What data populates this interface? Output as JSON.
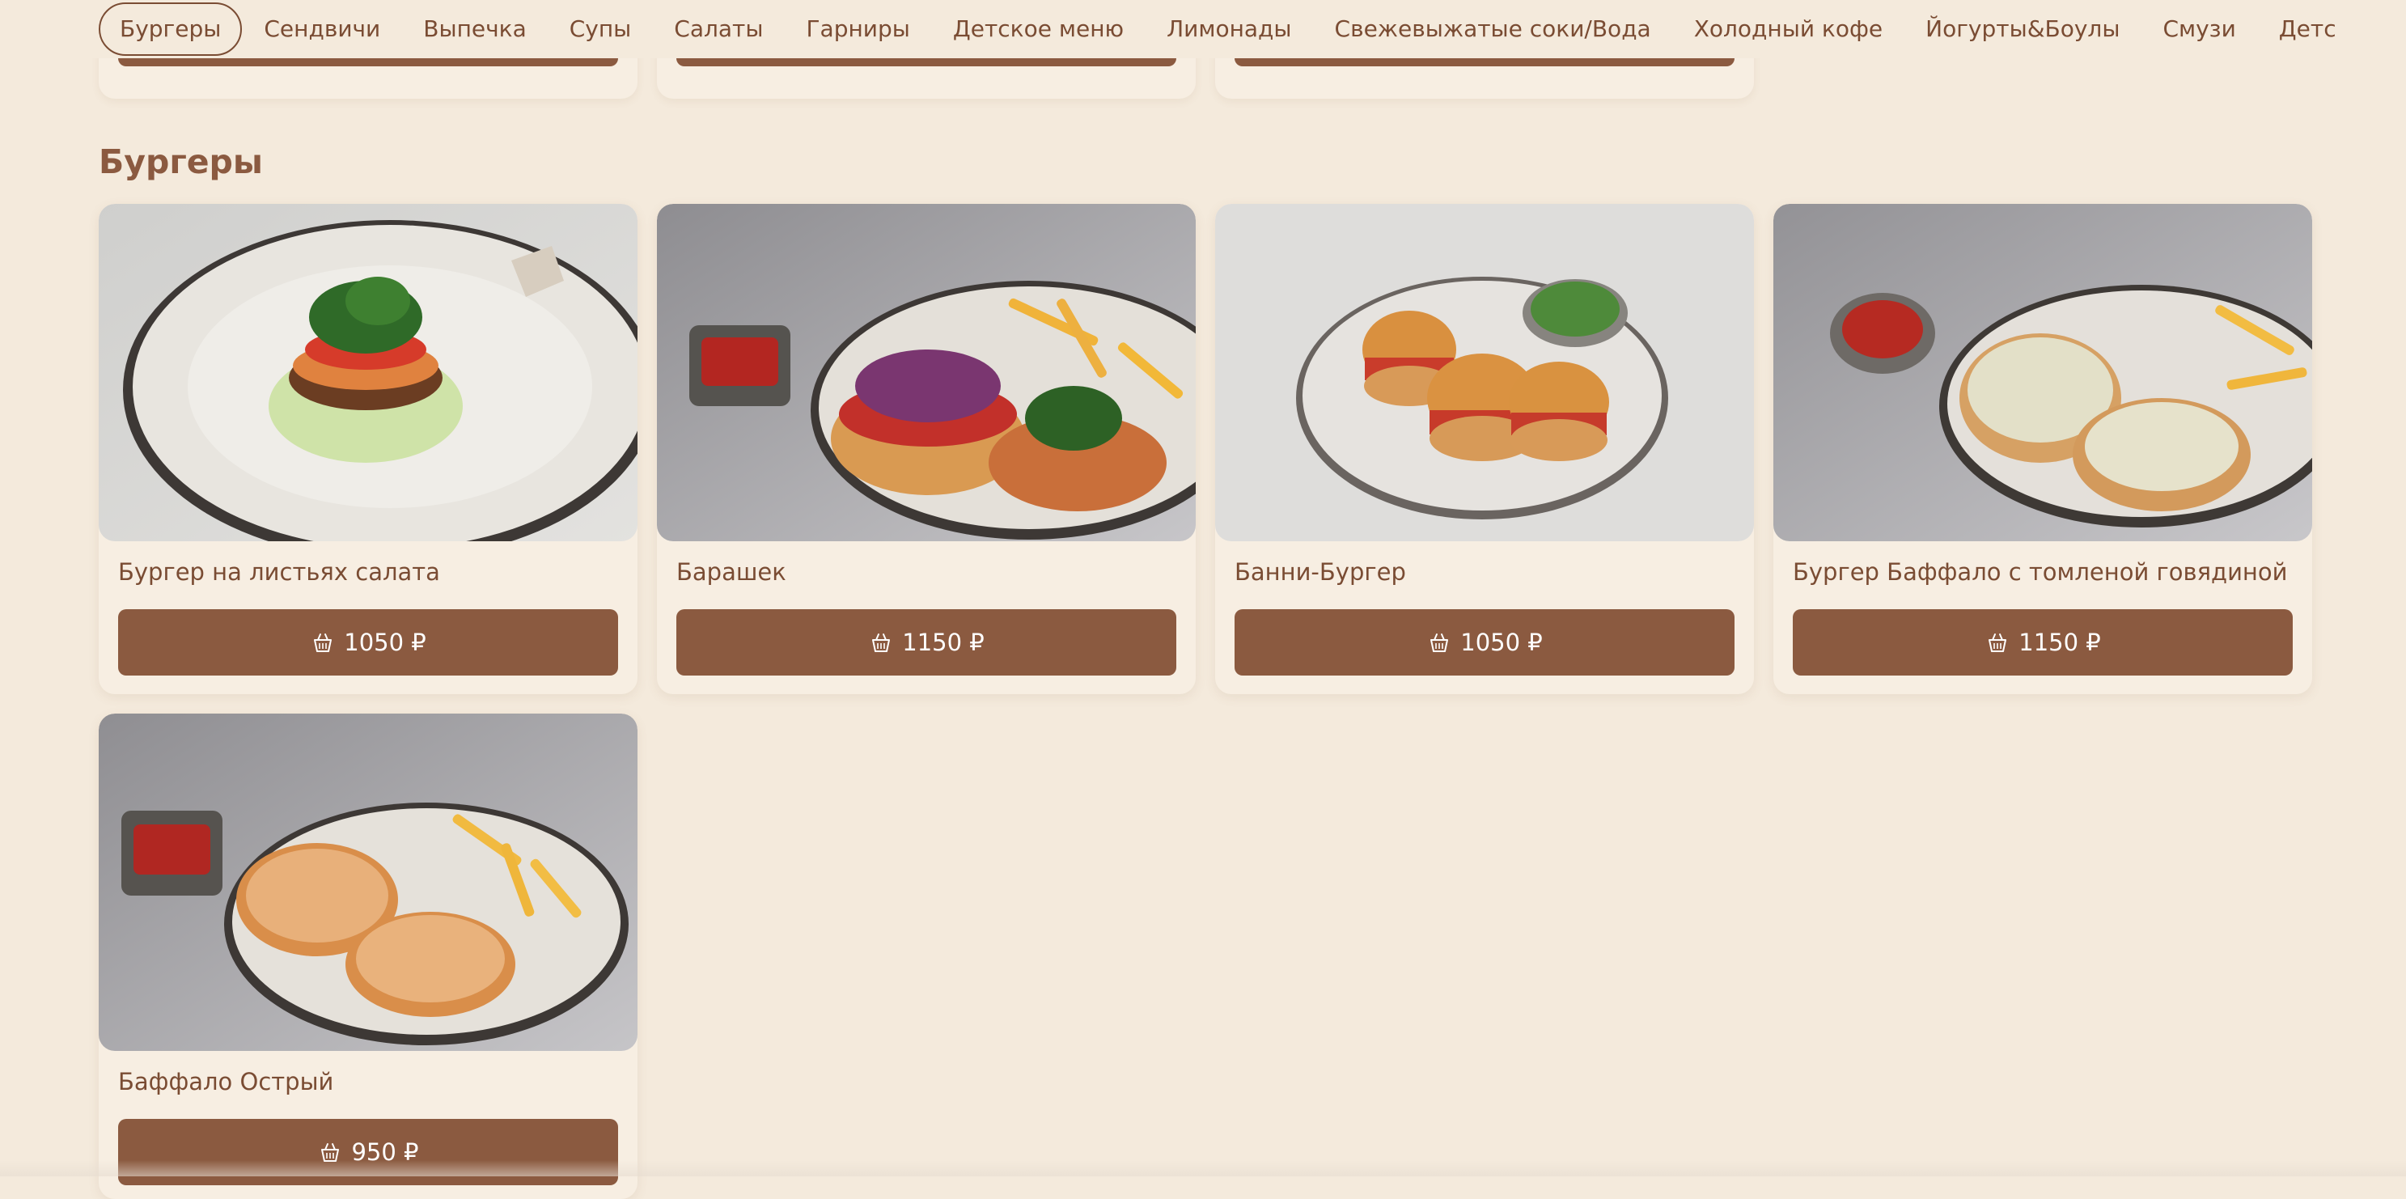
{
  "categories": [
    {
      "label": "Бургеры",
      "active": true
    },
    {
      "label": "Сендвичи"
    },
    {
      "label": "Выпечка"
    },
    {
      "label": "Супы"
    },
    {
      "label": "Салаты"
    },
    {
      "label": "Гарниры"
    },
    {
      "label": "Детское меню"
    },
    {
      "label": "Лимонады"
    },
    {
      "label": "Свежевыжатые соки/Вода"
    },
    {
      "label": "Холодный кофе"
    },
    {
      "label": "Йогурты&Боулы"
    },
    {
      "label": "Смузи"
    },
    {
      "label": "Детские напи"
    }
  ],
  "section": {
    "title": "Бургеры"
  },
  "products": [
    {
      "name": "Бургер на листьях салата",
      "price": "1050 ₽",
      "image_icon": "burger-on-lettuce-photo"
    },
    {
      "name": "Барашек",
      "price": "1150 ₽",
      "image_icon": "lamb-burger-photo"
    },
    {
      "name": "Банни-Бургер",
      "price": "1050 ₽",
      "image_icon": "mini-burgers-photo"
    },
    {
      "name": "Бургер Баффало с томленой говядиной",
      "price": "1150 ₽",
      "image_icon": "buffalo-burger-photo"
    },
    {
      "name": "Баффало Острый",
      "price": "950 ₽",
      "image_icon": "spicy-buffalo-photo"
    }
  ],
  "colors": {
    "background": "#F4EADC",
    "card": "#F7EEE2",
    "accent": "#8B5A40",
    "text": "#7A4C33"
  }
}
